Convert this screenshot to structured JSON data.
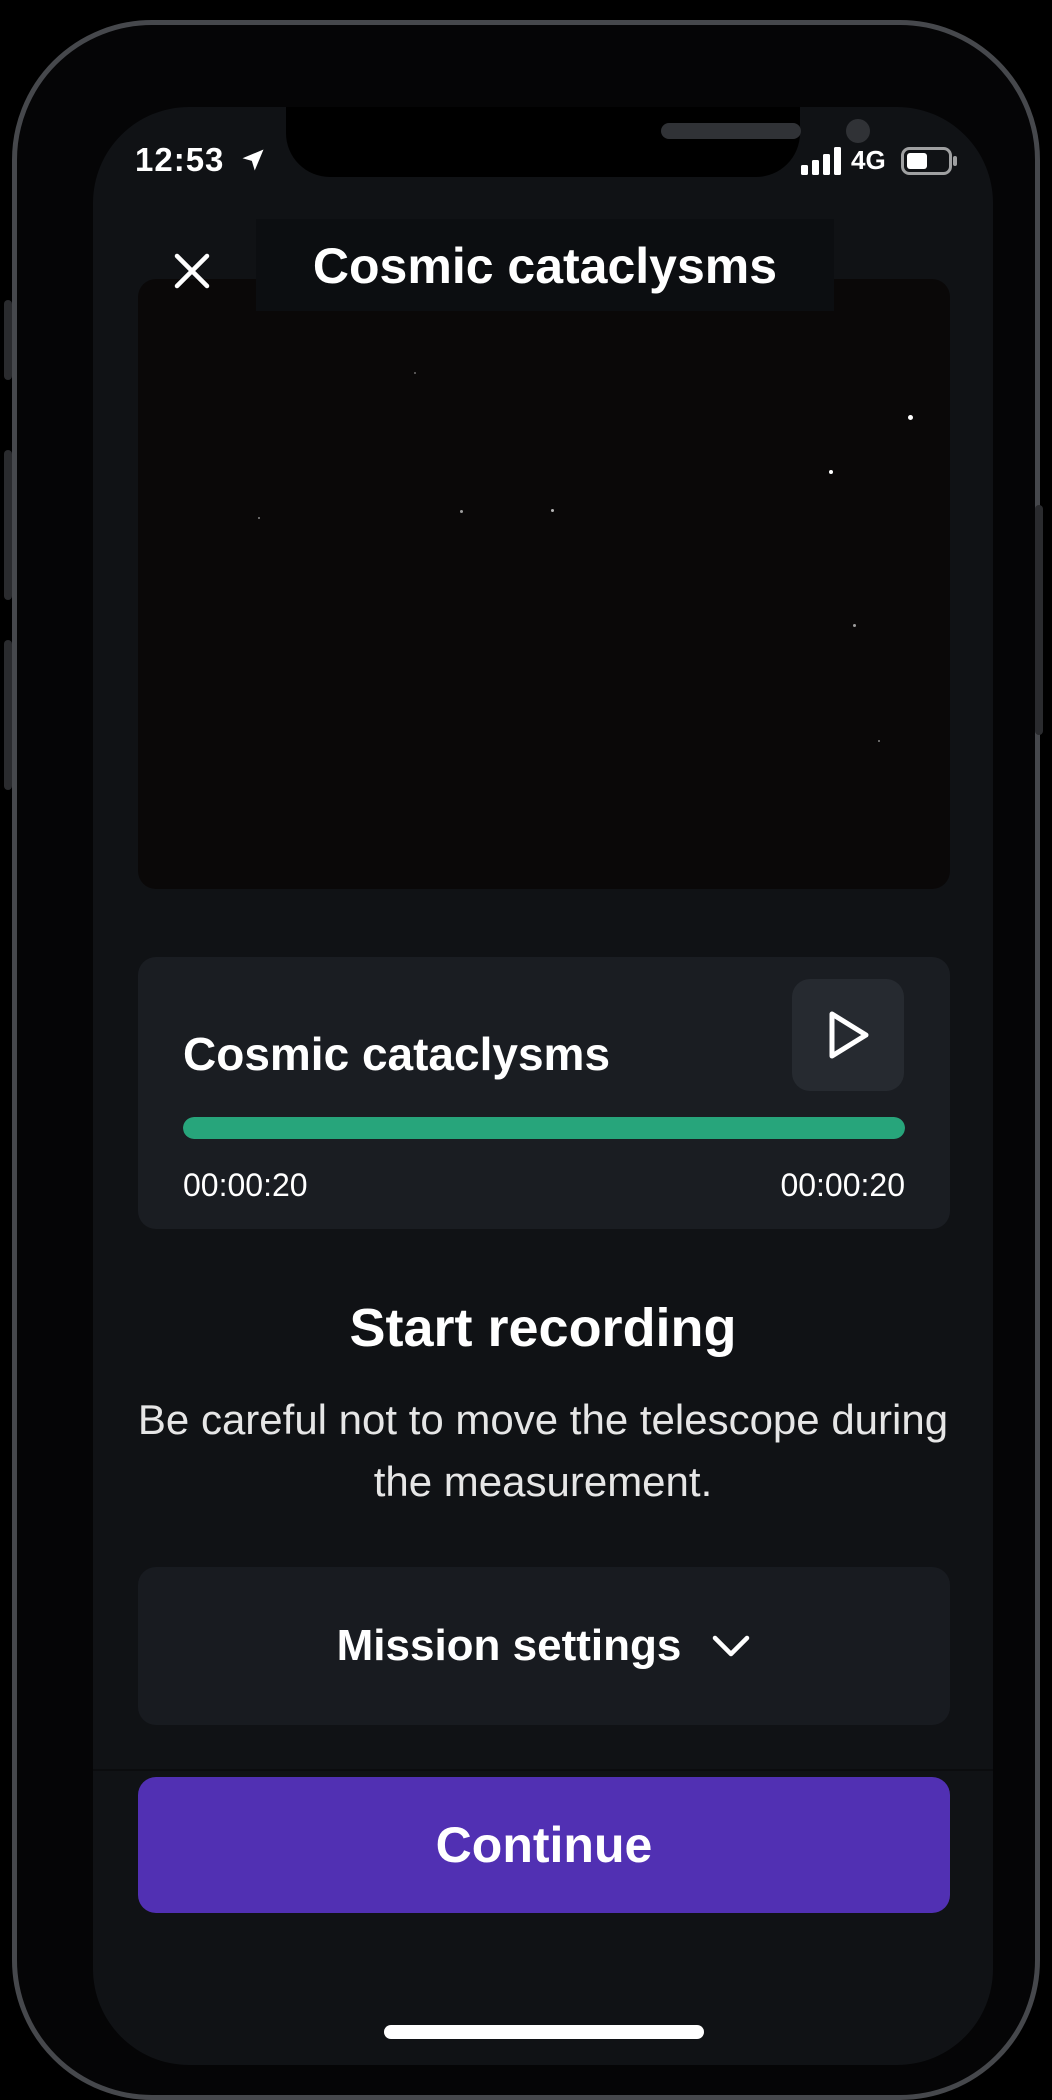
{
  "status_bar": {
    "time": "12:53",
    "network": "4G",
    "location_icon": "location-arrow-icon",
    "signal_icon": "cellular-signal-icon",
    "battery_icon": "battery-icon",
    "battery_level": 0.5
  },
  "header": {
    "title": "Cosmic cataclysms",
    "close_icon": "close-icon"
  },
  "player": {
    "title": "Cosmic cataclysms",
    "play_icon": "play-icon",
    "progress": 1.0,
    "elapsed": "00:00:20",
    "total": "00:00:20",
    "progress_color": "#27a57b"
  },
  "instructions": {
    "heading": "Start recording",
    "description": "Be careful not to move the telescope during the measurement."
  },
  "settings": {
    "label": "Mission settings",
    "chevron_icon": "chevron-down-icon"
  },
  "actions": {
    "continue_label": "Continue",
    "continue_color": "#5130b3"
  }
}
